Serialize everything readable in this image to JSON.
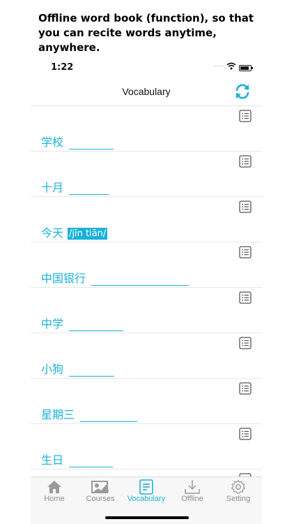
{
  "caption": "Offline word book (function), so that you can recite words anytime, anywhere.",
  "status_bar": {
    "time": "1:22",
    "signal": "....",
    "wifi": "wifi-icon",
    "battery": "battery-icon"
  },
  "navbar": {
    "title": "Vocabulary",
    "refresh_icon": "refresh-icon"
  },
  "colors": {
    "accent": "#1ab2d8",
    "inactive": "#8e8e8e",
    "divider": "#e8e8e8"
  },
  "vocabulary": [
    {
      "word": "学校",
      "pinyin": ""
    },
    {
      "word": "十月",
      "pinyin": ""
    },
    {
      "word": "今天",
      "pinyin": "/jīn tiān/"
    },
    {
      "word": "中国银行",
      "pinyin": ""
    },
    {
      "word": "中学",
      "pinyin": ""
    },
    {
      "word": "小狗",
      "pinyin": ""
    },
    {
      "word": "星期三",
      "pinyin": ""
    },
    {
      "word": "生日",
      "pinyin": ""
    }
  ],
  "tabs": [
    {
      "label": "Home",
      "icon": "home-icon",
      "active": false
    },
    {
      "label": "Courses",
      "icon": "courses-icon",
      "active": false
    },
    {
      "label": "Vocabulary",
      "icon": "vocabulary-icon",
      "active": true
    },
    {
      "label": "Offline",
      "icon": "download-icon",
      "active": false
    },
    {
      "label": "Setting",
      "icon": "gear-icon",
      "active": false
    }
  ]
}
